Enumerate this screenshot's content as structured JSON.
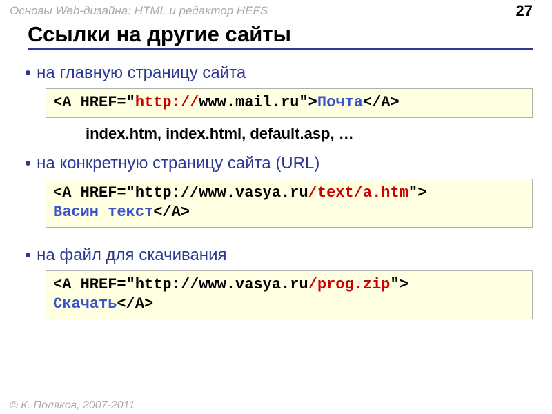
{
  "header": {
    "course": "Основы Web-дизайна: HTML и редактор HEFS",
    "page_number": "27"
  },
  "title": "Ссылки на другие сайты",
  "bullets": {
    "b1": "на главную страницу сайта",
    "b2": "на конкретную страницу сайта (URL)",
    "b3": "на файл для скачивания"
  },
  "code1": {
    "pre": "<A HREF=\"",
    "proto": "http://",
    "host": "www.mail.ru",
    "mid": "\">",
    "linktext": "Почта",
    "close": "</A>"
  },
  "note": "index.htm, index.html, default.asp, …",
  "code2": {
    "line1a": "<A HREF=\"http://www.vasya.ru",
    "line1b": "/text/a.htm",
    "line1c": "\">",
    "line2a": "Васин текст",
    "line2b": "</A>"
  },
  "code3": {
    "line1a": "<A HREF=\"http://www.vasya.ru",
    "line1b": "/prog.zip",
    "line1c": "\">",
    "line2a": "Скачать",
    "line2b": "</A>"
  },
  "footer": "© К. Поляков, 2007-2011"
}
